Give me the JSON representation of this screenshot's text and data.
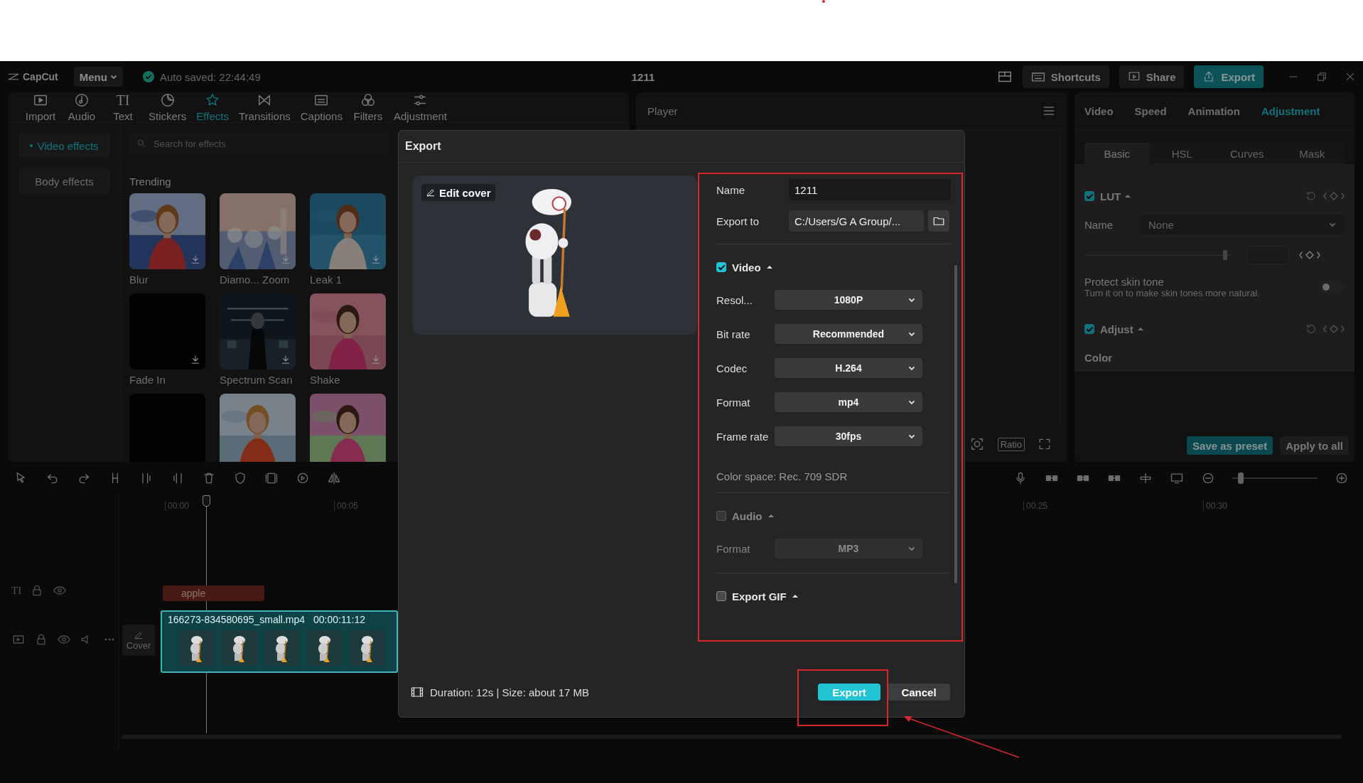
{
  "header": {
    "logo": "CapCut",
    "menu": "Menu",
    "autosave": "Auto saved: 22:44:49",
    "title": "1211",
    "shortcuts": "Shortcuts",
    "share": "Share",
    "export": "Export"
  },
  "media_tabs": [
    {
      "label": "Import",
      "selected": false
    },
    {
      "label": "Audio",
      "selected": false
    },
    {
      "label": "Text",
      "glyph": "TI",
      "selected": false
    },
    {
      "label": "Stickers",
      "selected": false
    },
    {
      "label": "Effects",
      "selected": true
    },
    {
      "label": "Transitions",
      "selected": false
    },
    {
      "label": "Captions",
      "selected": false
    },
    {
      "label": "Filters",
      "selected": false
    },
    {
      "label": "Adjustment",
      "selected": false
    }
  ],
  "effects_nav": [
    {
      "label": "Video effects",
      "selected": true
    },
    {
      "label": "Body effects",
      "selected": false
    }
  ],
  "effects_search": {
    "placeholder": "Search for effects"
  },
  "effects_heading": "Trending",
  "effects": [
    {
      "kind": "picture",
      "label": "Blur"
    },
    {
      "kind": "picture",
      "label": "Diamo... Zoom"
    },
    {
      "kind": "picture",
      "label": "Leak 1"
    },
    {
      "kind": "dark",
      "label": "Fade In"
    },
    {
      "kind": "picture",
      "label": "Spectrum Scan"
    },
    {
      "kind": "picture",
      "label": "Shake"
    },
    {
      "kind": "dark"
    },
    {
      "kind": "picture"
    },
    {
      "kind": "picture"
    }
  ],
  "player": {
    "title": "Player",
    "ratio": "Ratio"
  },
  "props_tabs": [
    {
      "label": "Video",
      "selected": false
    },
    {
      "label": "Speed",
      "selected": false
    },
    {
      "label": "Animation",
      "selected": false
    },
    {
      "label": "Adjustment",
      "selected": true
    }
  ],
  "props_subtabs": [
    {
      "label": "Basic",
      "selected": true
    },
    {
      "label": "HSL",
      "selected": false
    },
    {
      "label": "Curves",
      "selected": false
    },
    {
      "label": "Mask",
      "selected": false
    }
  ],
  "lut": {
    "label": "LUT",
    "checked": true,
    "name_label": "Name",
    "name_value": "None",
    "level": 0.96
  },
  "skin_tone": {
    "title": "Protect skin tone",
    "hint": "Turn it on to make skin tones more natural.",
    "on": false
  },
  "adjust": {
    "label": "Adjust",
    "checked": true,
    "color_label": "Color"
  },
  "props_buttons": [
    {
      "label": "Save as preset",
      "kind": "primary"
    },
    {
      "label": "Apply to all",
      "kind": "secondary"
    }
  ],
  "timeline": {
    "zoom": {
      "level": 0.1
    },
    "ticks": [
      "00:00",
      "00:05",
      "00:25",
      "00:30"
    ],
    "text_glyph": "TI",
    "text_clip": "apple",
    "video_clip": {
      "name": "166273-834580695_small.mp4",
      "duration": "00:00:11:12"
    },
    "cover": "Cover"
  },
  "dialog": {
    "title": "Export",
    "edit_cover": "Edit cover",
    "name": {
      "label": "Name",
      "value": "1211"
    },
    "export_to": {
      "label": "Export to",
      "value": "C:/Users/G A Group/..."
    },
    "video": {
      "label": "Video",
      "checked": true,
      "settings": [
        {
          "label": "Resol...",
          "value": "1080P"
        },
        {
          "label": "Bit rate",
          "value": "Recommended"
        },
        {
          "label": "Codec",
          "value": "H.264"
        },
        {
          "label": "Format",
          "value": "mp4"
        },
        {
          "label": "Frame rate",
          "value": "30fps"
        }
      ],
      "color_space": "Color space: Rec. 709 SDR"
    },
    "audio": {
      "label": "Audio",
      "checked": false,
      "disabled": true,
      "settings": [
        {
          "label": "Format",
          "value": "MP3"
        }
      ]
    },
    "gif": {
      "label": "Export GIF",
      "checked": false
    },
    "info": "Duration: 12s | Size: about 17 MB",
    "buttons": [
      {
        "label": "Export",
        "kind": "primary"
      },
      {
        "label": "Cancel",
        "kind": "secondary"
      }
    ]
  }
}
